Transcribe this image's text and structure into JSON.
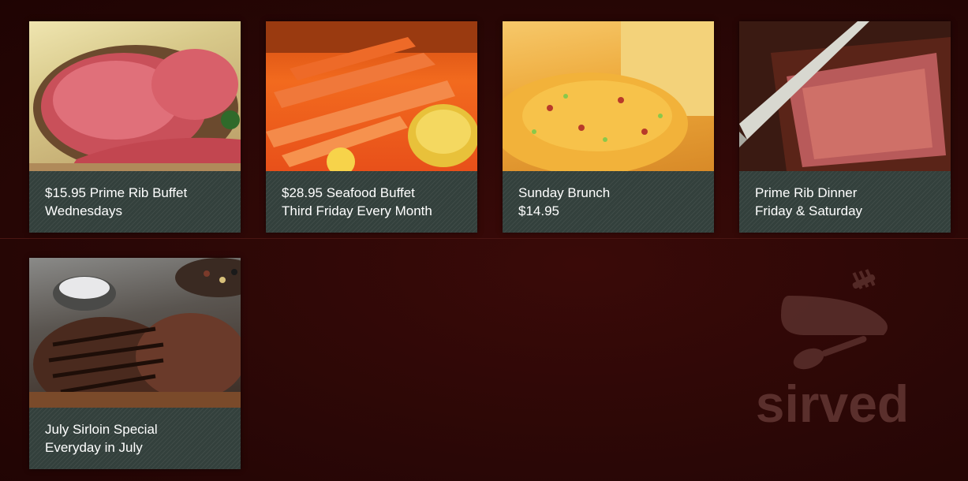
{
  "specials": [
    {
      "line1": "$15.95 Prime Rib Buffet",
      "line2": "Wednesdays",
      "image": "prime-rib-roast"
    },
    {
      "line1": "$28.95 Seafood Buffet",
      "line2": "Third Friday Every Month",
      "image": "crab-legs"
    },
    {
      "line1": "Sunday Brunch",
      "line2": "$14.95",
      "image": "omelette"
    },
    {
      "line1": "Prime Rib Dinner",
      "line2": "Friday & Saturday",
      "image": "carved-prime-rib"
    },
    {
      "line1": "July Sirloin Special",
      "line2": "Everyday in July",
      "image": "grilled-sirloin"
    }
  ],
  "watermark": {
    "text": "sirved",
    "icon": "knife-fork-spoon-icon"
  },
  "colors": {
    "background": "#2a0706",
    "caption_bg": "#33403c",
    "caption_text": "#ffffff",
    "watermark": "#5a2f2c"
  }
}
